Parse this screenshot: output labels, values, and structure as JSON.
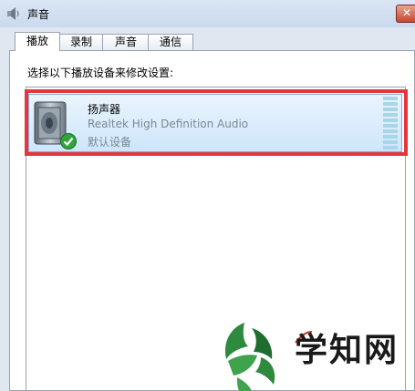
{
  "window": {
    "title": "声音",
    "close_label": "✕"
  },
  "tabs": [
    {
      "label": "播放",
      "active": true
    },
    {
      "label": "录制",
      "active": false
    },
    {
      "label": "声音",
      "active": false
    },
    {
      "label": "通信",
      "active": false
    }
  ],
  "playback": {
    "instruction": "选择以下播放设备来修改设置:",
    "devices": [
      {
        "name": "扬声器",
        "description": "Realtek High Definition Audio",
        "status": "默认设备",
        "icon": "speaker-icon",
        "default_badge_icon": "checkmark-icon",
        "level_meter_bars": 10
      }
    ]
  },
  "colors": {
    "highlight_border": "#e5363b",
    "selection_bg": "#cde6fb",
    "secondary_text": "#7a8896",
    "watermark_leaf": "#2d8a3e"
  },
  "watermark": {
    "text": "学知网",
    "logo_icon": "leaf-face-logo"
  }
}
